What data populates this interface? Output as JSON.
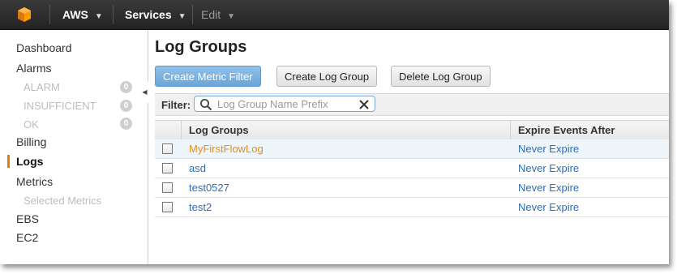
{
  "topnav": {
    "aws_label": "AWS",
    "services_label": "Services",
    "edit_label": "Edit",
    "logo_color": "#f90"
  },
  "sidebar": {
    "dashboard": "Dashboard",
    "alarms": "Alarms",
    "alarm_states": [
      {
        "label": "ALARM",
        "count": "0"
      },
      {
        "label": "INSUFFICIENT",
        "count": "0"
      },
      {
        "label": "OK",
        "count": "0"
      }
    ],
    "billing": "Billing",
    "logs": "Logs",
    "metrics": "Metrics",
    "selected_metrics": "Selected Metrics",
    "ebs": "EBS",
    "ec2": "EC2",
    "active_color": "#e47911"
  },
  "main": {
    "title": "Log Groups",
    "buttons": {
      "create_metric_filter": "Create Metric Filter",
      "create_log_group": "Create Log Group",
      "delete_log_group": "Delete Log Group"
    },
    "filter": {
      "label": "Filter:",
      "placeholder": "Log Group Name Prefix",
      "value": ""
    },
    "table": {
      "columns": [
        "Log Groups",
        "Expire Events After"
      ],
      "rows": [
        {
          "name": "MyFirstFlowLog",
          "expire": "Never Expire"
        },
        {
          "name": "asd",
          "expire": "Never Expire"
        },
        {
          "name": "test0527",
          "expire": "Never Expire"
        },
        {
          "name": "test2",
          "expire": "Never Expire"
        }
      ]
    }
  }
}
